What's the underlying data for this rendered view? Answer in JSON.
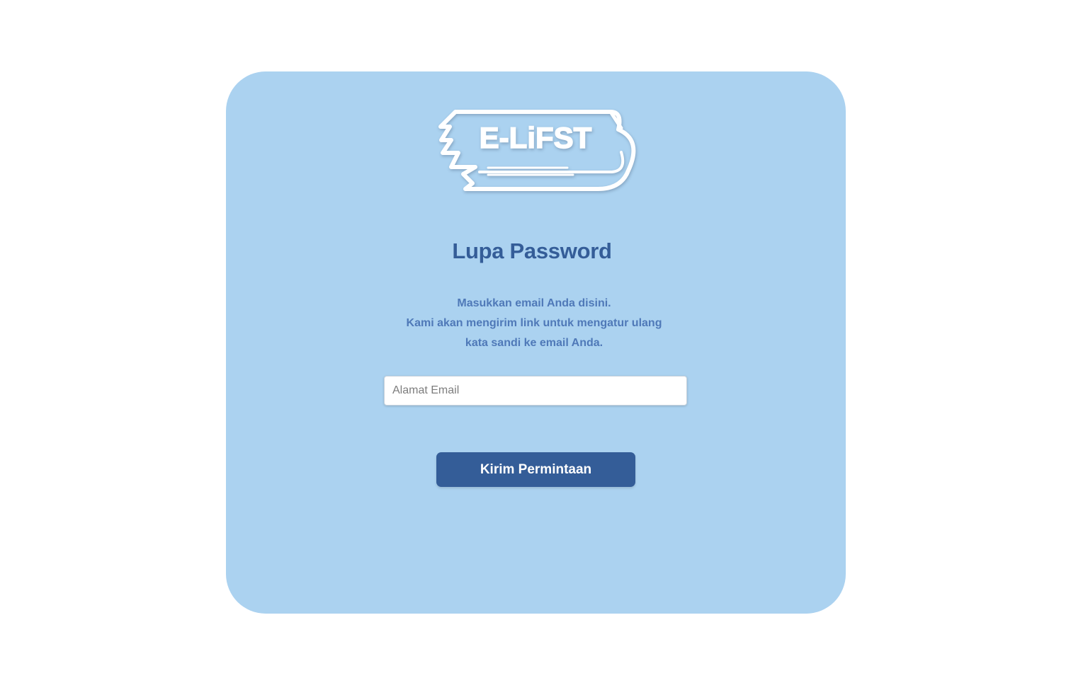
{
  "logo": {
    "text": "E-LiFST",
    "icon": "book-logo-icon"
  },
  "reset": {
    "title": "Lupa Password",
    "description": [
      "Masukkan email Anda disini.",
      "Kami akan mengirim link untuk mengatur ulang",
      "kata sandi ke email Anda."
    ],
    "email_placeholder": "Alamat Email",
    "email_value": "",
    "submit_label": "Kirim Permintaan"
  },
  "colors": {
    "card_background": "#abd2f0",
    "primary": "#345d98",
    "description_text": "#4f79b8",
    "page_background": "#ffffff"
  }
}
